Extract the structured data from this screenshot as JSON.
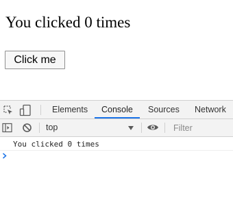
{
  "page": {
    "heading": "You clicked 0 times",
    "button_label": "Click me"
  },
  "devtools": {
    "tabs": [
      {
        "label": "Elements",
        "active": false
      },
      {
        "label": "Console",
        "active": true
      },
      {
        "label": "Sources",
        "active": false
      },
      {
        "label": "Network",
        "active": false
      }
    ],
    "toolbar": {
      "context": "top",
      "filter_placeholder": "Filter"
    },
    "console": {
      "messages": [
        "You clicked 0 times"
      ]
    }
  },
  "colors": {
    "active_tab_underline": "#1a73e8",
    "prompt_caret": "#1a73e8"
  },
  "icons": [
    "inspect-element-icon",
    "device-toolbar-icon",
    "sidebar-toggle-icon",
    "clear-console-icon",
    "dropdown-arrow-icon",
    "eye-icon",
    "prompt-chevron-icon",
    "mouse-cursor-icon"
  ]
}
